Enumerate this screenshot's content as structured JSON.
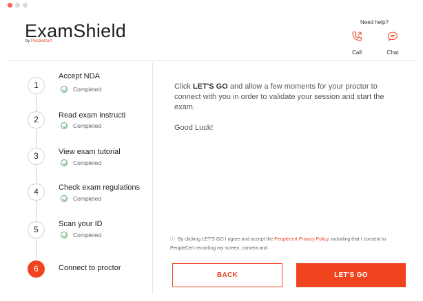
{
  "app": {
    "logo": "ExamShield",
    "logo_by": "by ",
    "logo_brand": "PeopleCert"
  },
  "help": {
    "title": "Need help?",
    "call_label": "Call",
    "chat_label": "Chat"
  },
  "steps": [
    {
      "number": "1",
      "title": "Accept NDA",
      "status": "Completed"
    },
    {
      "number": "2",
      "title": "Read exam instructi",
      "status": "Completed"
    },
    {
      "number": "3",
      "title": "View exam tutorial",
      "status": "Completed"
    },
    {
      "number": "4",
      "title": "Check exam regulations",
      "status": "Completed"
    },
    {
      "number": "5",
      "title": "Scan your ID",
      "status": "Completed"
    },
    {
      "number": "6",
      "title": "Connect to proctor",
      "status": ""
    }
  ],
  "main": {
    "instr_prefix": "Click ",
    "instr_bold": "LET'S GO",
    "instr_suffix": " and allow a few moments for your proctor to connect with you in order to validate your session and start the exam.",
    "luck": "Good Luck!",
    "consent_prefix": "By clicking LET'S GO I agree and accept the ",
    "consent_link": "Peoplecert Privacy Policy",
    "consent_suffix": ", including that I consent to PeopleCert recording my screen, camera and"
  },
  "buttons": {
    "back": "BACK",
    "go": "LET'S GO"
  },
  "colors": {
    "accent": "#f0441f",
    "check": "#5aa469"
  },
  "icons": {
    "call": "phone-icon",
    "chat": "chat-bubble-icon",
    "check": "check-circle-icon",
    "info": "info-icon"
  }
}
